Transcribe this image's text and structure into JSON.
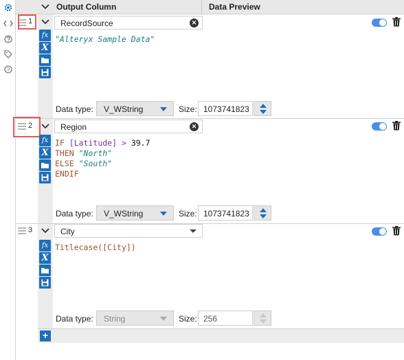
{
  "header": {
    "output_column_label": "Output Column",
    "data_preview_label": "Data Preview"
  },
  "rail": {
    "icons": [
      "gear-icon",
      "code-icon",
      "question-circle-icon",
      "tag-icon",
      "help-icon"
    ]
  },
  "rows": [
    {
      "number": "1",
      "name": "RecordSource",
      "expression": "\"Alteryx Sample Data\"",
      "data_type_label": "Data type:",
      "data_type": "V_WString",
      "size_label": "Size:",
      "size": "1073741823",
      "highlighted": true
    },
    {
      "number": "2",
      "name": "Region",
      "expression_lines": [
        "IF [Latitude] > 39.7",
        "THEN \"North\"",
        "ELSE \"South\"",
        "ENDIF"
      ],
      "data_type_label": "Data type:",
      "data_type": "V_WString",
      "size_label": "Size:",
      "size": "1073741823",
      "highlighted": true
    },
    {
      "number": "3",
      "name": "City",
      "expression": "Titlecase([City])",
      "data_type_label": "Data type:",
      "data_type": "String",
      "size_label": "Size:",
      "size": "256",
      "highlighted": false
    }
  ],
  "add_button_label": "+",
  "colors": {
    "accent": "#1d6fb8",
    "toggle": "#4a90e2",
    "highlight": "#e05a5a"
  }
}
